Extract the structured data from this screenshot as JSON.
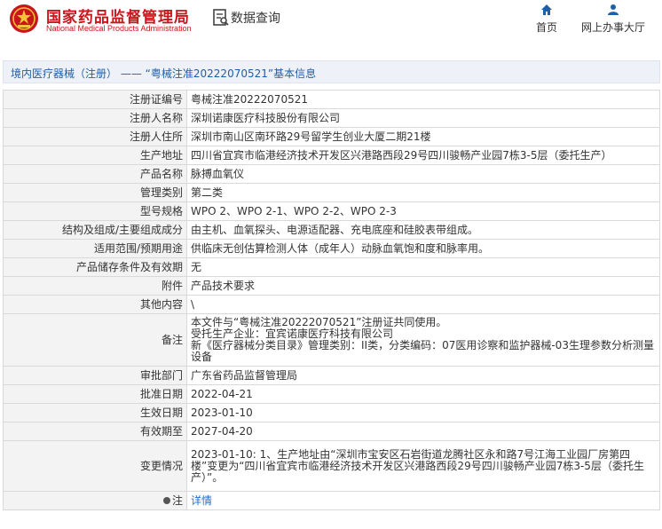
{
  "header": {
    "site_name_cn": "国家药品监督管理局",
    "site_name_en": "National Medical Products Administration",
    "section_title": "数据查询",
    "nav": [
      {
        "label": "首页",
        "icon": "home-icon"
      },
      {
        "label": "网上办事大厅",
        "icon": "user-icon"
      }
    ]
  },
  "colors": {
    "brand_red": "#c8161d",
    "link_blue": "#1f6fd1",
    "title_blue": "#1f5fa8"
  },
  "title_bar": {
    "category_link": "境内医疗器械（注册）",
    "separator": "——",
    "record_title": "“粤械注准20222070521”基本信息"
  },
  "rows": [
    {
      "label": "注册证编号",
      "value": "粤械注准20222070521"
    },
    {
      "label": "注册人名称",
      "value": "深圳诺康医疗科技股份有限公司"
    },
    {
      "label": "注册人住所",
      "value": "深圳市南山区南环路29号留学生创业大厦二期21楼"
    },
    {
      "label": "生产地址",
      "value": "四川省宜宾市临港经济技术开发区兴港路西段29号四川骏畅产业园7栋3-5层（委托生产）"
    },
    {
      "label": "产品名称",
      "value": "脉搏血氧仪"
    },
    {
      "label": "管理类别",
      "value": "第二类"
    },
    {
      "label": "型号规格",
      "value": "WPO 2、WPO 2-1、WPO 2-2、WPO 2-3"
    },
    {
      "label": "结构及组成/主要组成成分",
      "value": "由主机、血氧探头、电源适配器、充电底座和硅胶表带组成。"
    },
    {
      "label": "适用范围/预期用途",
      "value": "供临床无创估算检测人体（成年人）动脉血氧饱和度和脉率用。"
    },
    {
      "label": "产品储存条件及有效期",
      "value": "无"
    },
    {
      "label": "附件",
      "value": "产品技术要求"
    },
    {
      "label": "其他内容",
      "value": "\\"
    }
  ],
  "remarks": {
    "label": "备注",
    "line1": "本文件与“粤械注准20222070521”注册证共同使用。",
    "line2": "受托生产企业：宜宾诺康医疗科技有限公司",
    "line3": "新《医疗器械分类目录》管理类别：II类，分类编码：07医用诊察和监护器械-03生理参数分析测量设备"
  },
  "rows2": [
    {
      "label": "审批部门",
      "value": "广东省药品监督管理局"
    },
    {
      "label": "批准日期",
      "value": "2022-04-21"
    },
    {
      "label": "生效日期",
      "value": "2023-01-10"
    },
    {
      "label": "有效期至",
      "value": "2027-04-20"
    }
  ],
  "change": {
    "label": "变更情况",
    "value": "2023-01-10: 1、生产地址由“深圳市宝安区石岩街道龙腾社区永和路7号江海工业园厂房第四楼”变更为“四川省宜宾市临港经济技术开发区兴港路西段29号四川骏畅产业园7栋3-5层（委托生产）”。"
  },
  "tip": {
    "label": "注",
    "link_text": "详情"
  }
}
